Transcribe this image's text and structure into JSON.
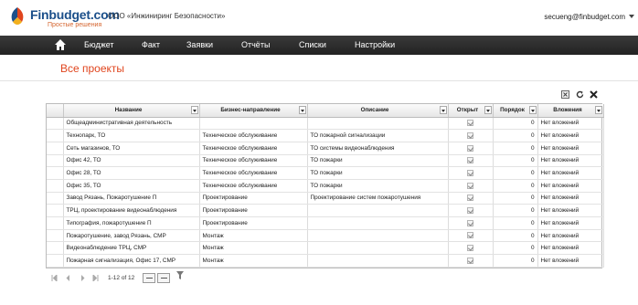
{
  "header": {
    "logo_text": "Finbudget.com",
    "logo_sub": "Простые решения",
    "company": "ООО «Инжиниринг Безопасности»",
    "user": "secueng@finbudget.com"
  },
  "nav": {
    "items": [
      {
        "label": "Бюджет"
      },
      {
        "label": "Факт"
      },
      {
        "label": "Заявки"
      },
      {
        "label": "Отчёты"
      },
      {
        "label": "Списки"
      },
      {
        "label": "Настройки"
      }
    ]
  },
  "page_title": "Все проекты",
  "table": {
    "columns": [
      "Название",
      "Бизнес-направление",
      "Описание",
      "Открыт",
      "Порядок",
      "Вложения"
    ],
    "rows": [
      {
        "name": "Общеадминистративная деятельность",
        "direction": "",
        "desc": "",
        "order": "0",
        "attach": "Нет вложений"
      },
      {
        "name": "Технопарк, ТО",
        "direction": "Техническое обслуживание",
        "desc": "ТО пожарной сигнализации",
        "order": "0",
        "attach": "Нет вложений"
      },
      {
        "name": "Сеть магазинов, ТО",
        "direction": "Техническое обслуживание",
        "desc": "ТО системы видеонаблюдения",
        "order": "0",
        "attach": "Нет вложений"
      },
      {
        "name": "Офис 42, ТО",
        "direction": "Техническое обслуживание",
        "desc": "ТО пожарки",
        "order": "0",
        "attach": "Нет вложений"
      },
      {
        "name": "Офис 28, ТО",
        "direction": "Техническое обслуживание",
        "desc": "ТО пожарки",
        "order": "0",
        "attach": "Нет вложений"
      },
      {
        "name": "Офис 35, ТО",
        "direction": "Техническое обслуживание",
        "desc": "ТО пожарки",
        "order": "0",
        "attach": "Нет вложений"
      },
      {
        "name": "Завод Рязань, Пожаротушение П",
        "direction": "Проектирование",
        "desc": "Проектирование систем пожаротушения",
        "order": "0",
        "attach": "Нет вложений"
      },
      {
        "name": "ТРЦ, проектирование видеонаблюдения",
        "direction": "Проектирование",
        "desc": "",
        "order": "0",
        "attach": "Нет вложений"
      },
      {
        "name": "Типография, пожаротушение П",
        "direction": "Проектирование",
        "desc": "",
        "order": "0",
        "attach": "Нет вложений"
      },
      {
        "name": "Пожаротушение, завод Рязань, СМР",
        "direction": "Монтаж",
        "desc": "",
        "order": "0",
        "attach": "Нет вложений"
      },
      {
        "name": "Видеонаблюдение ТРЦ, СМР",
        "direction": "Монтаж",
        "desc": "",
        "order": "0",
        "attach": "Нет вложений"
      },
      {
        "name": "Пожарная сигнализация, Офис 17, СМР",
        "direction": "Монтаж",
        "desc": "",
        "order": "0",
        "attach": "Нет вложений"
      }
    ]
  },
  "pager": {
    "range": "1-12 of 12"
  },
  "colors": {
    "accent": "#e0451e",
    "logo_blue": "#1b4f8a",
    "nav_bg": "#2b2b2b"
  }
}
